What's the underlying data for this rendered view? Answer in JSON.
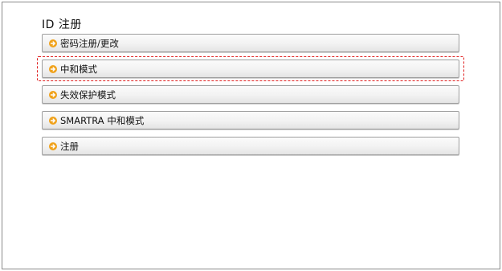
{
  "page": {
    "title": "ID 注册"
  },
  "menu": {
    "items": [
      {
        "label": "密码注册/更改"
      },
      {
        "label": "中和模式"
      },
      {
        "label": "失效保护模式"
      },
      {
        "label": "SMARTRA 中和模式"
      },
      {
        "label": "注册"
      }
    ]
  },
  "colors": {
    "arrow_icon": "#f0a21c",
    "highlight": "#e02020"
  }
}
